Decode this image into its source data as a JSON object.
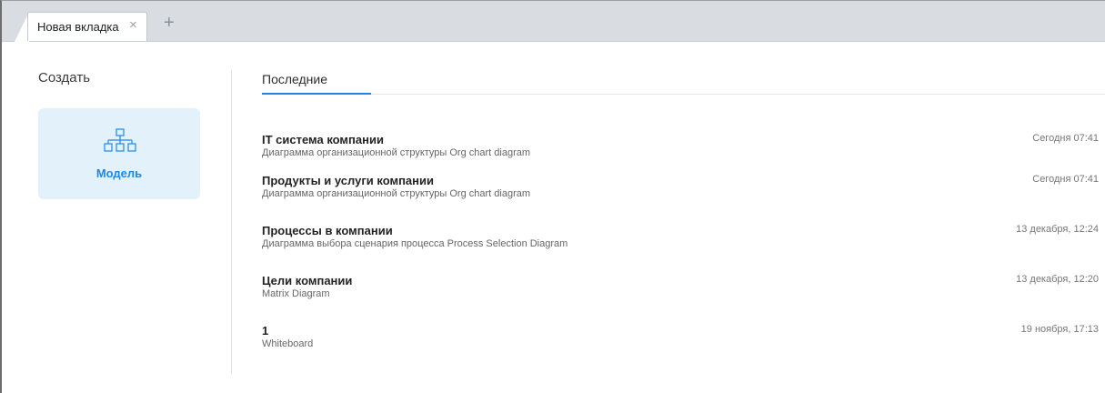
{
  "tabbar": {
    "tab_label": "Новая вкладка",
    "close_glyph": "×",
    "new_tab_glyph": "+"
  },
  "create": {
    "title": "Создать",
    "model_label": "Модель",
    "icon": "org-chart-icon"
  },
  "recent": {
    "tab_label": "Последние",
    "items": [
      {
        "title": "IT система компании",
        "subtitle": "Диаграмма организационной структуры Org chart diagram",
        "date": "Сегодня 07:41"
      },
      {
        "title": "Продукты и услуги компании",
        "subtitle": "Диаграмма организационной структуры Org chart diagram",
        "date": "Сегодня 07:41"
      },
      {
        "title": "Процессы в компании",
        "subtitle": "Диаграмма выбора сценария процесса Process Selection Diagram",
        "date": "13 декабря, 12:24"
      },
      {
        "title": "Цели компании",
        "subtitle": "Matrix Diagram",
        "date": "13 декабря, 12:20"
      },
      {
        "title": "1",
        "subtitle": "Whiteboard",
        "date": "19 ноября, 17:13"
      }
    ]
  },
  "colors": {
    "accent": "#1e88e5",
    "card_bg": "#e3f1fb",
    "tabbar_bg": "#d9dde2"
  }
}
